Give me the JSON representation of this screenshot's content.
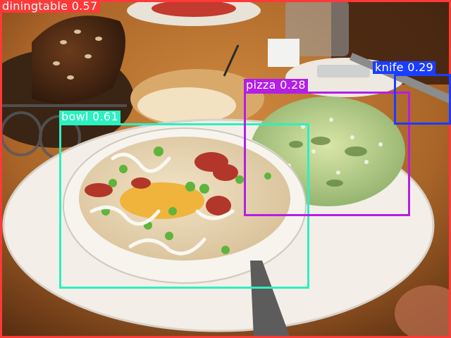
{
  "image": {
    "description_free": true,
    "colors": {
      "table": "#b77834",
      "plate": "#f3efe8",
      "soup": "#e8d8b8",
      "salad": "#b6cf84"
    }
  },
  "detections": [
    {
      "key": "diningtable",
      "label": "diningtable",
      "score": "0.57",
      "text": "diningtable 0.57",
      "color": "#ff3838"
    },
    {
      "key": "bowl",
      "label": "bowl",
      "score": "0.61",
      "text": "bowl 0.61",
      "color": "#2bf0c0"
    },
    {
      "key": "pizza",
      "label": "pizza",
      "score": "0.28",
      "text": "pizza 0.28",
      "color": "#b41ee6"
    },
    {
      "key": "knife",
      "label": "knife",
      "score": "0.29",
      "text": "knife 0.29",
      "color": "#1a3dff"
    }
  ]
}
